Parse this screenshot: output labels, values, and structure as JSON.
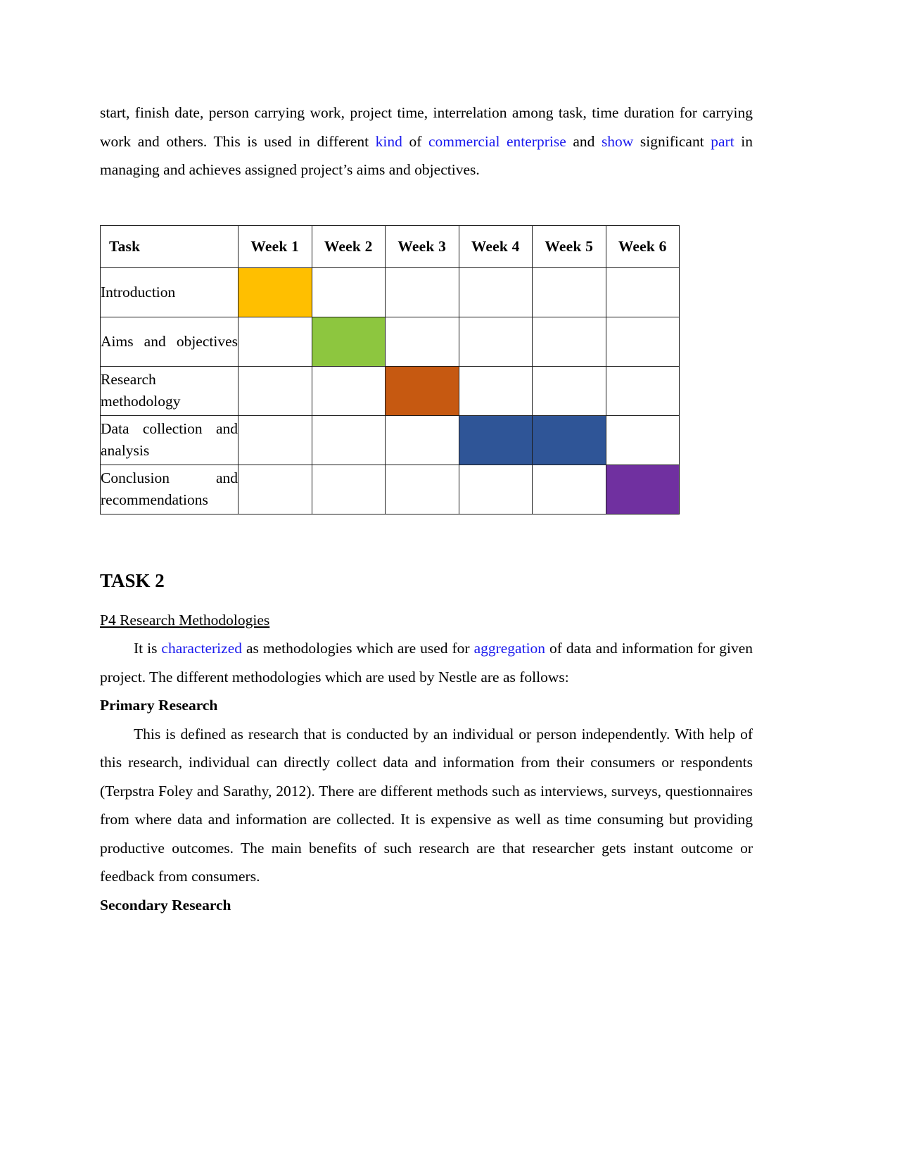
{
  "page": {
    "background": "#ffffff",
    "text_color": "#000000",
    "link_color": "#1a1aee"
  },
  "intro_paragraph": {
    "seg1": "start, finish date, person carrying work, project time, interrelation among task, time duration for carrying work and others. This is used in different ",
    "hl1": "kind",
    "seg2": " of ",
    "hl2": "commercial enterprise",
    "seg3": " and ",
    "hl3": "show",
    "seg4": " significant ",
    "hl4": "part",
    "seg5": " in managing and achieves assigned project’s aims and objectives."
  },
  "gantt": {
    "columns": [
      "Task",
      "Week 1",
      "Week 2",
      "Week 3",
      "Week 4",
      "Week 5",
      "Week 6"
    ],
    "rows": [
      {
        "task": "Introduction",
        "filled": [
          1
        ],
        "color": "#FFBF00"
      },
      {
        "task": "Aims and objectives",
        "filled": [
          2
        ],
        "color": "#8DC63F"
      },
      {
        "task": "Research methodology",
        "filled": [
          3
        ],
        "color": "#C65911"
      },
      {
        "task": "Data collection and analysis",
        "filled": [
          4,
          5
        ],
        "color": "#2F5597"
      },
      {
        "task": "Conclusion and recommendations",
        "filled": [
          6
        ],
        "color": "#7030A0"
      }
    ]
  },
  "chart_data": {
    "type": "table",
    "title": "Gantt chart",
    "categories": [
      "Week 1",
      "Week 2",
      "Week 3",
      "Week 4",
      "Week 5",
      "Week 6"
    ],
    "series": [
      {
        "name": "Introduction",
        "start_week": 1,
        "end_week": 1,
        "values": [
          1,
          0,
          0,
          0,
          0,
          0
        ],
        "color": "#FFBF00"
      },
      {
        "name": "Aims and objectives",
        "start_week": 2,
        "end_week": 2,
        "values": [
          0,
          1,
          0,
          0,
          0,
          0
        ],
        "color": "#8DC63F"
      },
      {
        "name": "Research methodology",
        "start_week": 3,
        "end_week": 3,
        "values": [
          0,
          0,
          1,
          0,
          0,
          0
        ],
        "color": "#C65911"
      },
      {
        "name": "Data collection and analysis",
        "start_week": 4,
        "end_week": 5,
        "values": [
          0,
          0,
          0,
          1,
          1,
          0
        ],
        "color": "#2F5597"
      },
      {
        "name": "Conclusion and recommendations",
        "start_week": 6,
        "end_week": 6,
        "values": [
          0,
          0,
          0,
          0,
          0,
          1
        ],
        "color": "#7030A0"
      }
    ],
    "xlabel": "Week",
    "ylabel": "Task",
    "grid": true,
    "legend": "none"
  },
  "task2": {
    "heading": "TASK 2",
    "subheading": "P4 Research Methodologies",
    "intro": {
      "seg1": "It is ",
      "hl1": "characterized",
      "seg2": " as methodologies which are used for ",
      "hl2": "aggregation",
      "seg3": " of data and information for given project. The different methodologies which are used by Nestle are as follows:"
    },
    "primary": {
      "heading": "Primary Research",
      "body": "This is defined as research that is conducted by an individual or person independently. With help of this research, individual can directly collect data and information from their consumers or respondents (Terpstra Foley and Sarathy, 2012). There are different methods such as interviews, surveys, questionnaires from where data and information are collected. It is expensive as well as time consuming but providing productive outcomes. The main benefits of such research are that researcher gets instant outcome or feedback from consumers."
    },
    "secondary": {
      "heading": "Secondary Research"
    }
  }
}
